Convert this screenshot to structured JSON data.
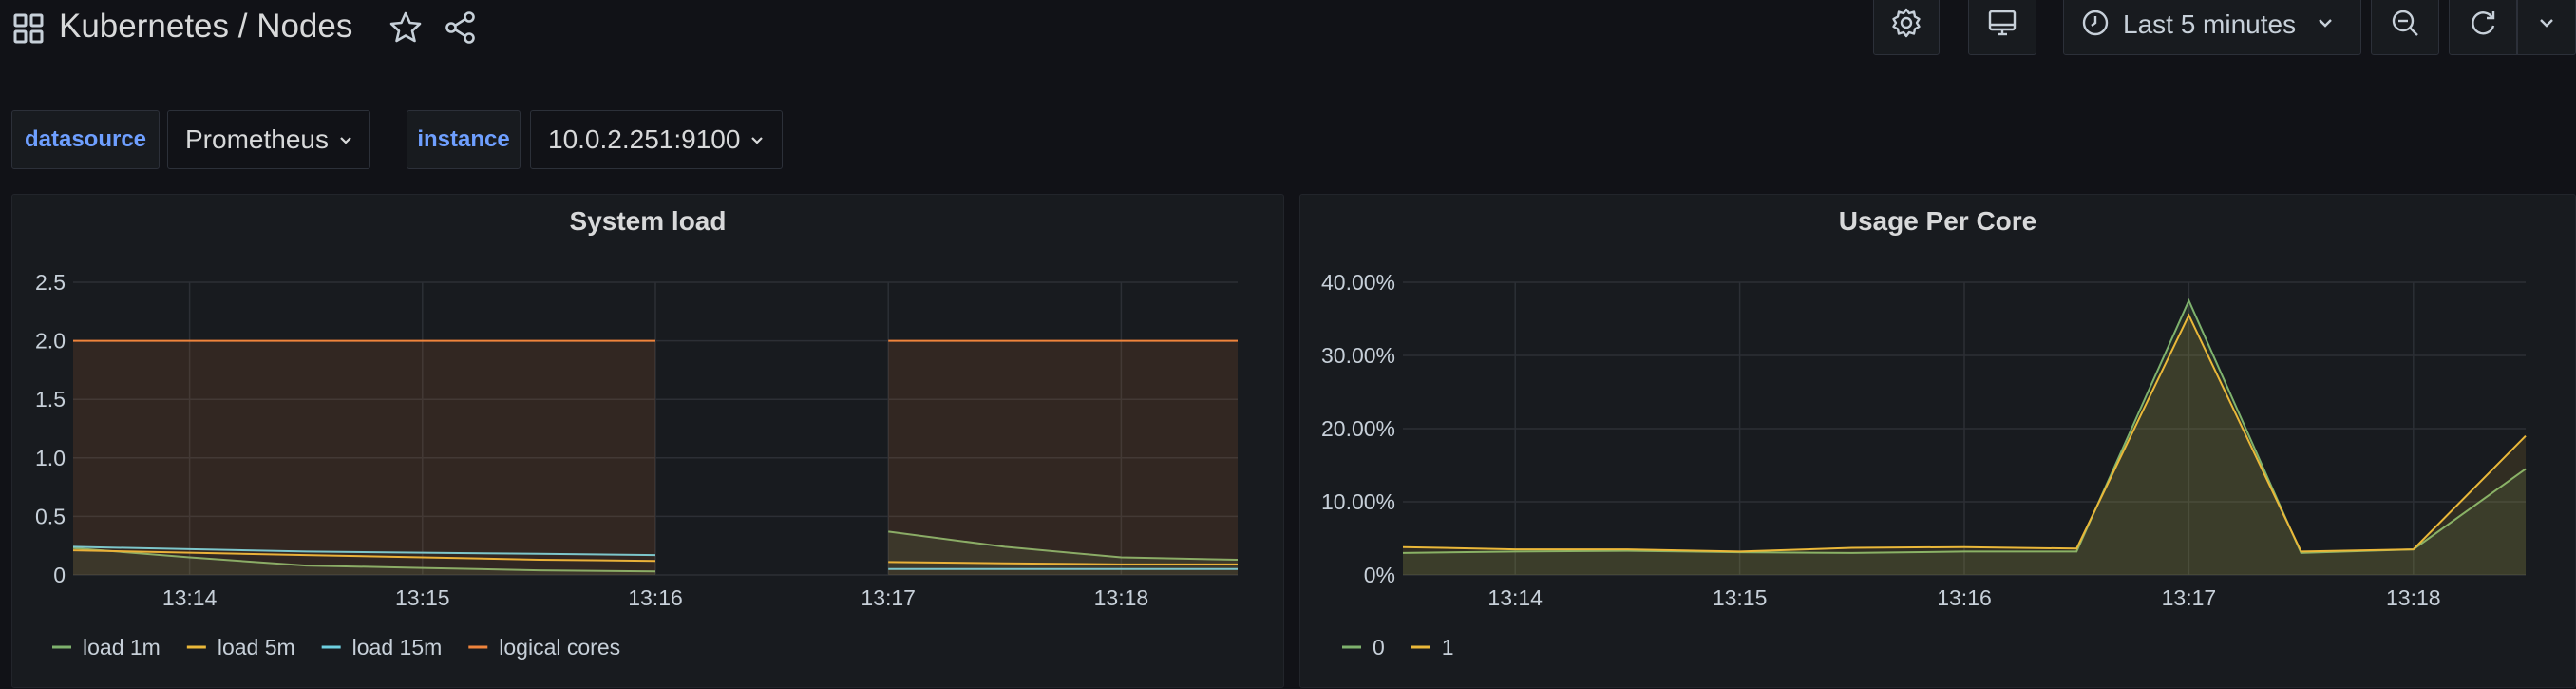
{
  "header": {
    "title": "Kubernetes / Nodes",
    "time_range": "Last 5 minutes"
  },
  "variables": [
    {
      "label": "datasource",
      "value": "Prometheus"
    },
    {
      "label": "instance",
      "value": "10.0.2.251:9100"
    }
  ],
  "colors": {
    "background": "#111217",
    "panel": "#181b1f",
    "variable_label": "#6e9fff",
    "load_1m": "#7eb26d",
    "load_5m": "#eab839",
    "load_15m": "#6ed0e0",
    "logical_cores": "#ef843c",
    "core_0": "#7eb26d",
    "core_1": "#eab839"
  },
  "panels": {
    "system_load": {
      "title": "System load",
      "chart_data": {
        "type": "line",
        "x": [
          "13:13:30",
          "13:14",
          "13:14:30",
          "13:15",
          "13:15:30",
          "13:16",
          "13:16:30",
          "13:17",
          "13:17:30",
          "13:18",
          "13:18:30"
        ],
        "x_tick_labels": [
          "13:14",
          "13:15",
          "13:16",
          "13:17",
          "13:18"
        ],
        "y_tick_labels": [
          "0",
          "0.5",
          "1.0",
          "1.5",
          "2.0",
          "2.5"
        ],
        "ylim": [
          0,
          2.5
        ],
        "gap_after_index": 5,
        "series": [
          {
            "name": "load 1m",
            "color_key": "load_1m",
            "values": [
              0.23,
              0.15,
              0.08,
              0.06,
              0.04,
              0.03,
              null,
              0.37,
              0.24,
              0.15,
              0.13
            ],
            "fill": true
          },
          {
            "name": "load 5m",
            "color_key": "load_5m",
            "values": [
              0.21,
              0.19,
              0.17,
              0.15,
              0.13,
              0.12,
              null,
              0.11,
              0.1,
              0.09,
              0.09
            ],
            "fill": false
          },
          {
            "name": "load 15m",
            "color_key": "load_15m",
            "values": [
              0.24,
              0.22,
              0.2,
              0.19,
              0.18,
              0.17,
              null,
              0.05,
              0.05,
              0.05,
              0.05
            ],
            "fill": false
          },
          {
            "name": "logical cores",
            "color_key": "logical_cores",
            "values": [
              2,
              2,
              2,
              2,
              2,
              2,
              null,
              2,
              2,
              2,
              2
            ],
            "fill": true
          }
        ],
        "legend": "bottom-left"
      }
    },
    "usage_per_core": {
      "title": "Usage Per Core",
      "chart_data": {
        "type": "area",
        "x": [
          "13:13:30",
          "13:14",
          "13:14:30",
          "13:15",
          "13:15:30",
          "13:16",
          "13:16:30",
          "13:17",
          "13:17:30",
          "13:18",
          "13:18:30"
        ],
        "x_tick_labels": [
          "13:14",
          "13:15",
          "13:16",
          "13:17",
          "13:18"
        ],
        "y_tick_labels": [
          "0%",
          "10.00%",
          "20.00%",
          "30.00%",
          "40.00%"
        ],
        "ylim": [
          0,
          40
        ],
        "series": [
          {
            "name": "0",
            "color_key": "core_0",
            "values": [
              3.0,
              3.2,
              3.3,
              3.1,
              3.0,
              3.2,
              3.2,
              37.5,
              3.0,
              3.5,
              14.5
            ]
          },
          {
            "name": "1",
            "color_key": "core_1",
            "values": [
              3.8,
              3.5,
              3.5,
              3.2,
              3.7,
              3.8,
              3.6,
              35.5,
              3.2,
              3.5,
              19.0
            ]
          }
        ],
        "legend": "bottom-left"
      }
    }
  }
}
